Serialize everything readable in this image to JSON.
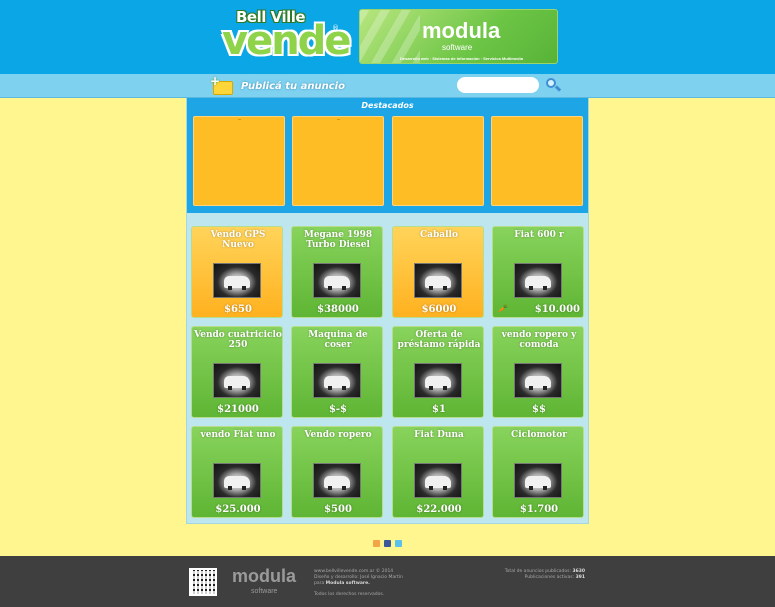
{
  "header": {
    "logo_top": "Bell Ville",
    "logo_main": "vende",
    "logo_reg": "®",
    "banner_title": "modula",
    "banner_sub": "software",
    "banner_tagline": "Desarrollo web · Sistemas de Información · Servicios Multimedia"
  },
  "nav": {
    "publish_label": "Publicá tu anuncio",
    "search_placeholder": ""
  },
  "featured": {
    "title": "Destacados"
  },
  "listings": [
    {
      "title": "Vendo GPS Nuevo",
      "price": "$650",
      "style": "orange"
    },
    {
      "title": "Megane 1998 Turbo Diesel",
      "price": "$38000",
      "style": "green"
    },
    {
      "title": "Caballo",
      "price": "$6000",
      "style": "orange"
    },
    {
      "title": "Fiat 600 r",
      "price": "$10.000",
      "style": "green"
    },
    {
      "title": "Vendo cuatriciclo 250",
      "price": "$21000",
      "style": "green"
    },
    {
      "title": "Maquina de coser",
      "price": "$-$",
      "style": "green"
    },
    {
      "title": "Oferta de préstamo rápida",
      "price": "$1",
      "style": "green"
    },
    {
      "title": "vendo ropero y comoda",
      "price": "$$",
      "style": "green"
    },
    {
      "title": "vendo Fiat uno",
      "price": "$25.000",
      "style": "green"
    },
    {
      "title": "Vendo ropero",
      "price": "$500",
      "style": "green"
    },
    {
      "title": "Fiat Duna",
      "price": "$22.000",
      "style": "green"
    },
    {
      "title": "Ciclomotor",
      "price": "$1.700",
      "style": "green"
    }
  ],
  "footer": {
    "logo": "modula",
    "logo_sub": "software",
    "site": "www.bellvillevende.com.ar © 2014",
    "credits": "Diseño y desarrollo: José Ignacio Martín",
    "para": "para",
    "company": "Modula software.",
    "rights": "Todos los derechos reservados.",
    "total_label": "Total de anuncios publicados:",
    "total_value": "3630",
    "active_label": "Publicaciones activas:",
    "active_value": "391"
  }
}
